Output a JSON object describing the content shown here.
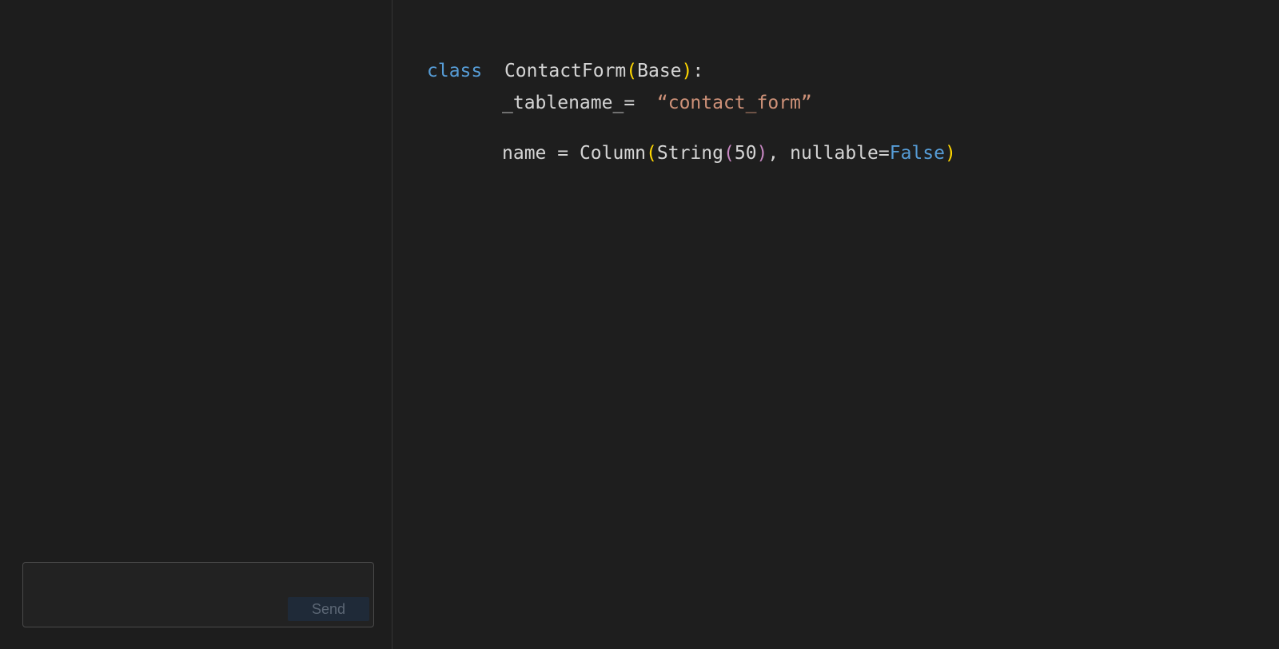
{
  "chat": {
    "composer_placeholder": "",
    "send_label": "Send"
  },
  "editor": {
    "line1": {
      "keyword": "class",
      "class_name": "ContactForm",
      "open_paren": "(",
      "base": "Base",
      "close_paren": ")",
      "colon": ":"
    },
    "line2": {
      "attribute": "_tablename_=",
      "value": "“contact_form”"
    },
    "line3": {
      "field": "name = ",
      "func": "Column",
      "open_paren": "(",
      "type": "String",
      "inner_open": "(",
      "length": "50",
      "inner_close": ")",
      "args": ", nullable=",
      "constant": "False",
      "close_paren": ")"
    }
  },
  "colors": {
    "keyword": "#569cd6",
    "string": "#ce9178",
    "bracket_outer": "#ffd700",
    "bracket_inner": "#c586c0",
    "send_button_bg": "#1f2a38"
  }
}
